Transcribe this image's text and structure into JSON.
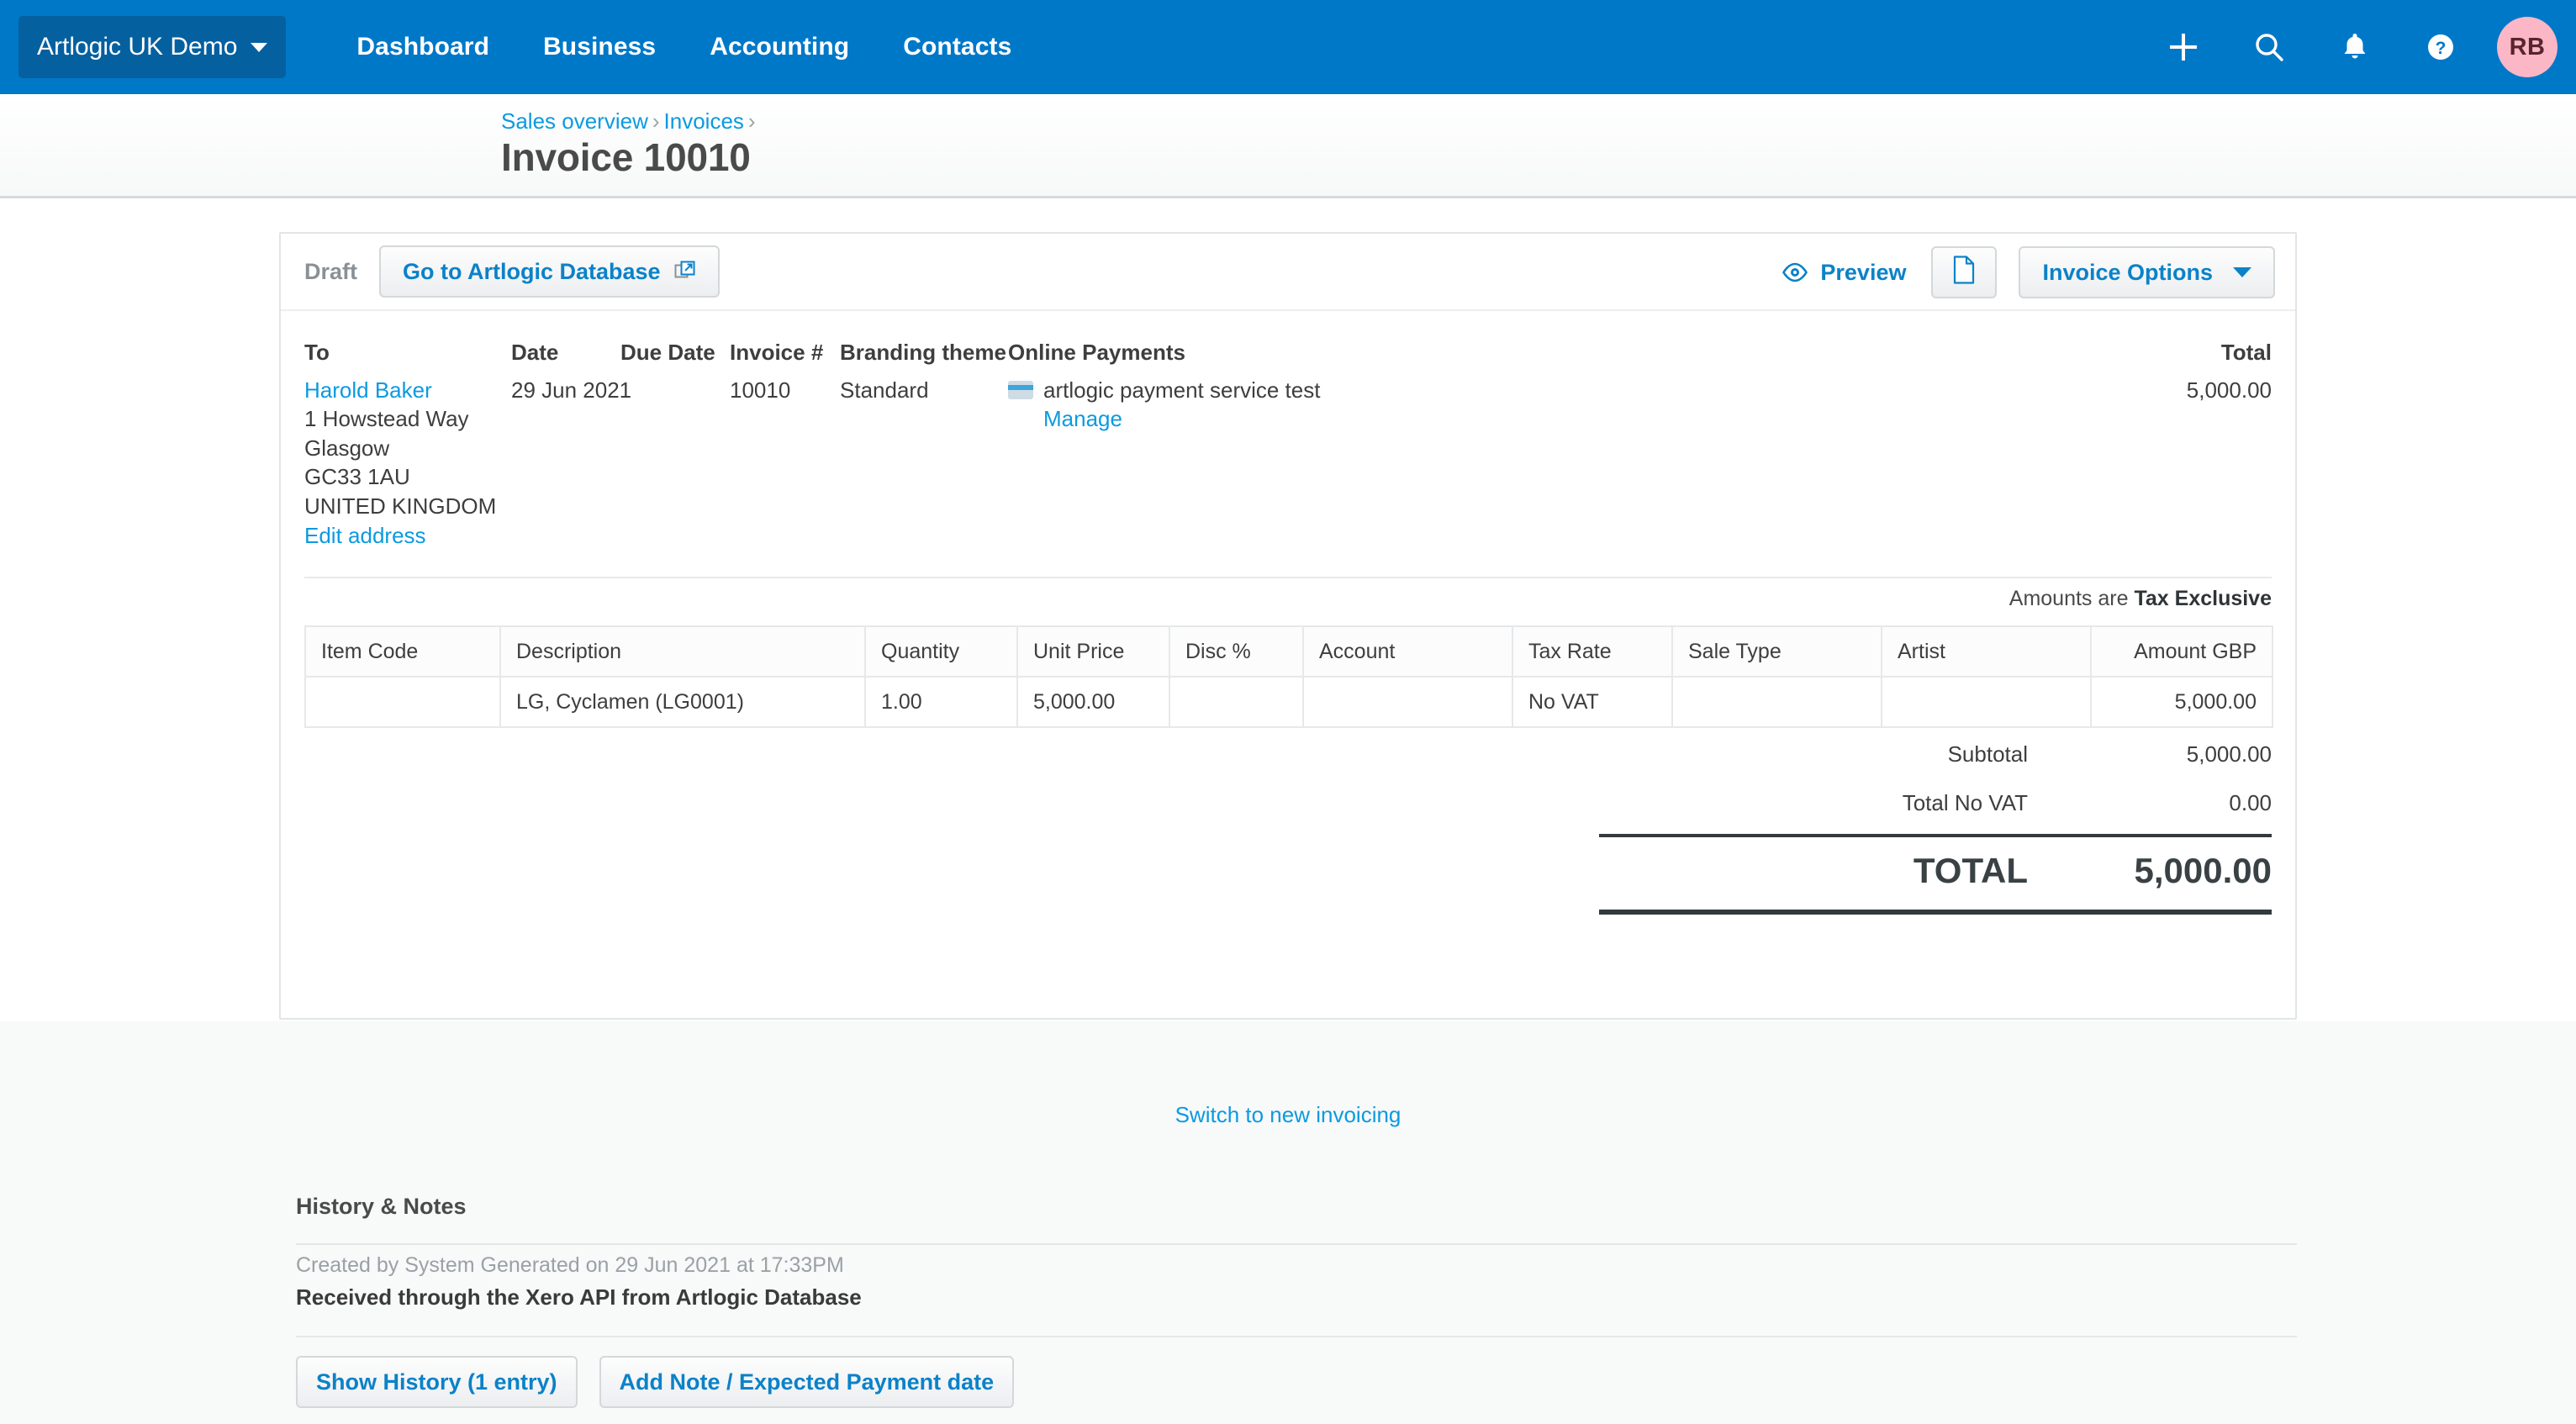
{
  "topnav": {
    "org_name": "Artlogic UK Demo",
    "links": [
      "Dashboard",
      "Business",
      "Accounting",
      "Contacts"
    ],
    "icons": [
      "plus-icon",
      "search-icon",
      "bell-icon",
      "help-icon"
    ],
    "avatar_initials": "RB",
    "accent": "#0078C8",
    "avatar_bg": "#FBB7C5"
  },
  "breadcrumb": {
    "items": [
      "Sales overview",
      "Invoices"
    ],
    "separator": "›"
  },
  "page": {
    "title": "Invoice 10010"
  },
  "toolbar": {
    "status": "Draft",
    "go_to_database": "Go to Artlogic Database",
    "preview": "Preview",
    "invoice_options": "Invoice Options"
  },
  "invoice": {
    "to_label": "To",
    "to_name": "Harold Baker",
    "address": [
      "1 Howstead Way",
      "Glasgow",
      "GC33 1AU",
      "UNITED KINGDOM"
    ],
    "edit_address": "Edit address",
    "date_label": "Date",
    "date_value": "29 Jun 2021",
    "due_date_label": "Due Date",
    "due_date_value": "",
    "invoice_no_label": "Invoice #",
    "invoice_no_value": "10010",
    "branding_label": "Branding theme",
    "branding_value": "Standard",
    "online_payments_label": "Online Payments",
    "payment_service": "artlogic payment service test",
    "payment_manage": "Manage",
    "total_label": "Total",
    "total_value": "5,000.00",
    "tax_note_prefix": "Amounts are",
    "tax_note_value": "Tax Exclusive"
  },
  "items_table": {
    "columns": [
      "Item Code",
      "Description",
      "Quantity",
      "Unit Price",
      "Disc %",
      "Account",
      "Tax Rate",
      "Sale Type",
      "Artist",
      "Amount GBP"
    ],
    "rows": [
      {
        "item_code": "",
        "description": "LG, Cyclamen (LG0001)",
        "quantity": "1.00",
        "unit_price": "5,000.00",
        "disc": "",
        "account": "",
        "tax_rate": "No VAT",
        "sale_type": "",
        "artist": "",
        "amount": "5,000.00"
      }
    ]
  },
  "totals": {
    "subtotal_label": "Subtotal",
    "subtotal_value": "5,000.00",
    "tax_label": "Total No VAT",
    "tax_value": "0.00",
    "grand_label": "TOTAL",
    "grand_value": "5,000.00"
  },
  "footer": {
    "switch_link": "Switch to new invoicing",
    "history_title": "History & Notes",
    "history_meta": "Created by System Generated on 29 Jun 2021 at 17:33PM",
    "history_text": "Received through the Xero API from Artlogic Database",
    "show_history_button": "Show History (1 entry)",
    "add_note_button": "Add Note / Expected Payment date"
  }
}
